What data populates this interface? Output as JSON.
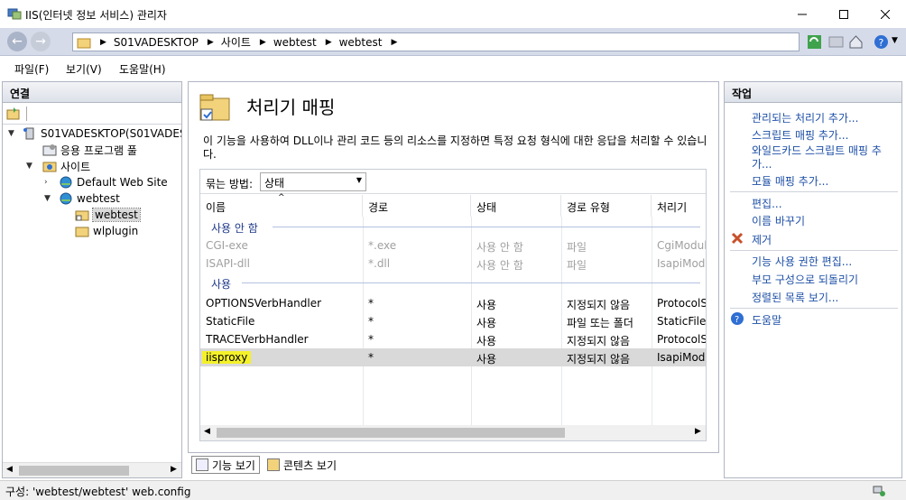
{
  "window": {
    "title": "IIS(인터넷 정보 서비스) 관리자"
  },
  "address": {
    "crumbs": [
      "S01VADESKTOP",
      "사이트",
      "webtest",
      "webtest"
    ]
  },
  "menu": [
    "파일(F)",
    "보기(V)",
    "도움말(H)"
  ],
  "connections": {
    "header": "연결",
    "tree": {
      "server": "S01VADESKTOP(S01VADESK",
      "app_pools": "응용 프로그램 풀",
      "sites": "사이트",
      "default_site": "Default Web Site",
      "webtest": "webtest",
      "webtest_child": "webtest",
      "wlplugin": "wlplugin"
    }
  },
  "feature": {
    "title": "처리기 매핑",
    "description": "이 기능을 사용하여 DLL이나 관리 코드 등의 리소스를 지정하면 특정 요청 형식에 대한 응답을 처리할 수 있습니다.",
    "group_by_label": "묶는 방법:",
    "group_by_value": "상태",
    "columns": [
      "이름",
      "경로",
      "상태",
      "경로 유형",
      "처리기"
    ],
    "groups": [
      {
        "label": "사용 안 함",
        "rows": [
          [
            "CGI-exe",
            "*.exe",
            "사용 안 함",
            "파일",
            "CgiModul"
          ],
          [
            "ISAPI-dll",
            "*.dll",
            "사용 안 함",
            "파일",
            "IsapiModu"
          ]
        ]
      },
      {
        "label": "사용",
        "rows": [
          [
            "OPTIONSVerbHandler",
            "*",
            "사용",
            "지정되지 않음",
            "ProtocolSu"
          ],
          [
            "StaticFile",
            "*",
            "사용",
            "파일 또는 폴더",
            "StaticFileM"
          ],
          [
            "TRACEVerbHandler",
            "*",
            "사용",
            "지정되지 않음",
            "ProtocolSu"
          ],
          [
            "iisproxy",
            "*",
            "사용",
            "지정되지 않음",
            "IsapiModu"
          ]
        ]
      }
    ]
  },
  "view_tabs": {
    "feature_view": "기능 보기",
    "content_view": "콘텐츠 보기"
  },
  "actions": {
    "header": "작업",
    "add_managed": "관리되는 처리기 추가...",
    "add_script": "스크립트 매핑 추가...",
    "add_wildcard_1": "와일드카드 스크립트 매핑 추",
    "add_wildcard_2": "가...",
    "add_module": "모듈 매핑 추가...",
    "edit": "편집...",
    "rename": "이름 바꾸기",
    "remove": "제거",
    "edit_permissions": "기능 사용 권한 편집...",
    "revert": "부모 구성으로 되돌리기",
    "view_ordered": "정렬된 목록 보기...",
    "help": "도움말"
  },
  "status": {
    "text": "구성: 'webtest/webtest' web.config"
  },
  "colors": {
    "link": "#1d4fa6",
    "highlight": "#f4f12a",
    "accent": "#d6dbe9"
  }
}
